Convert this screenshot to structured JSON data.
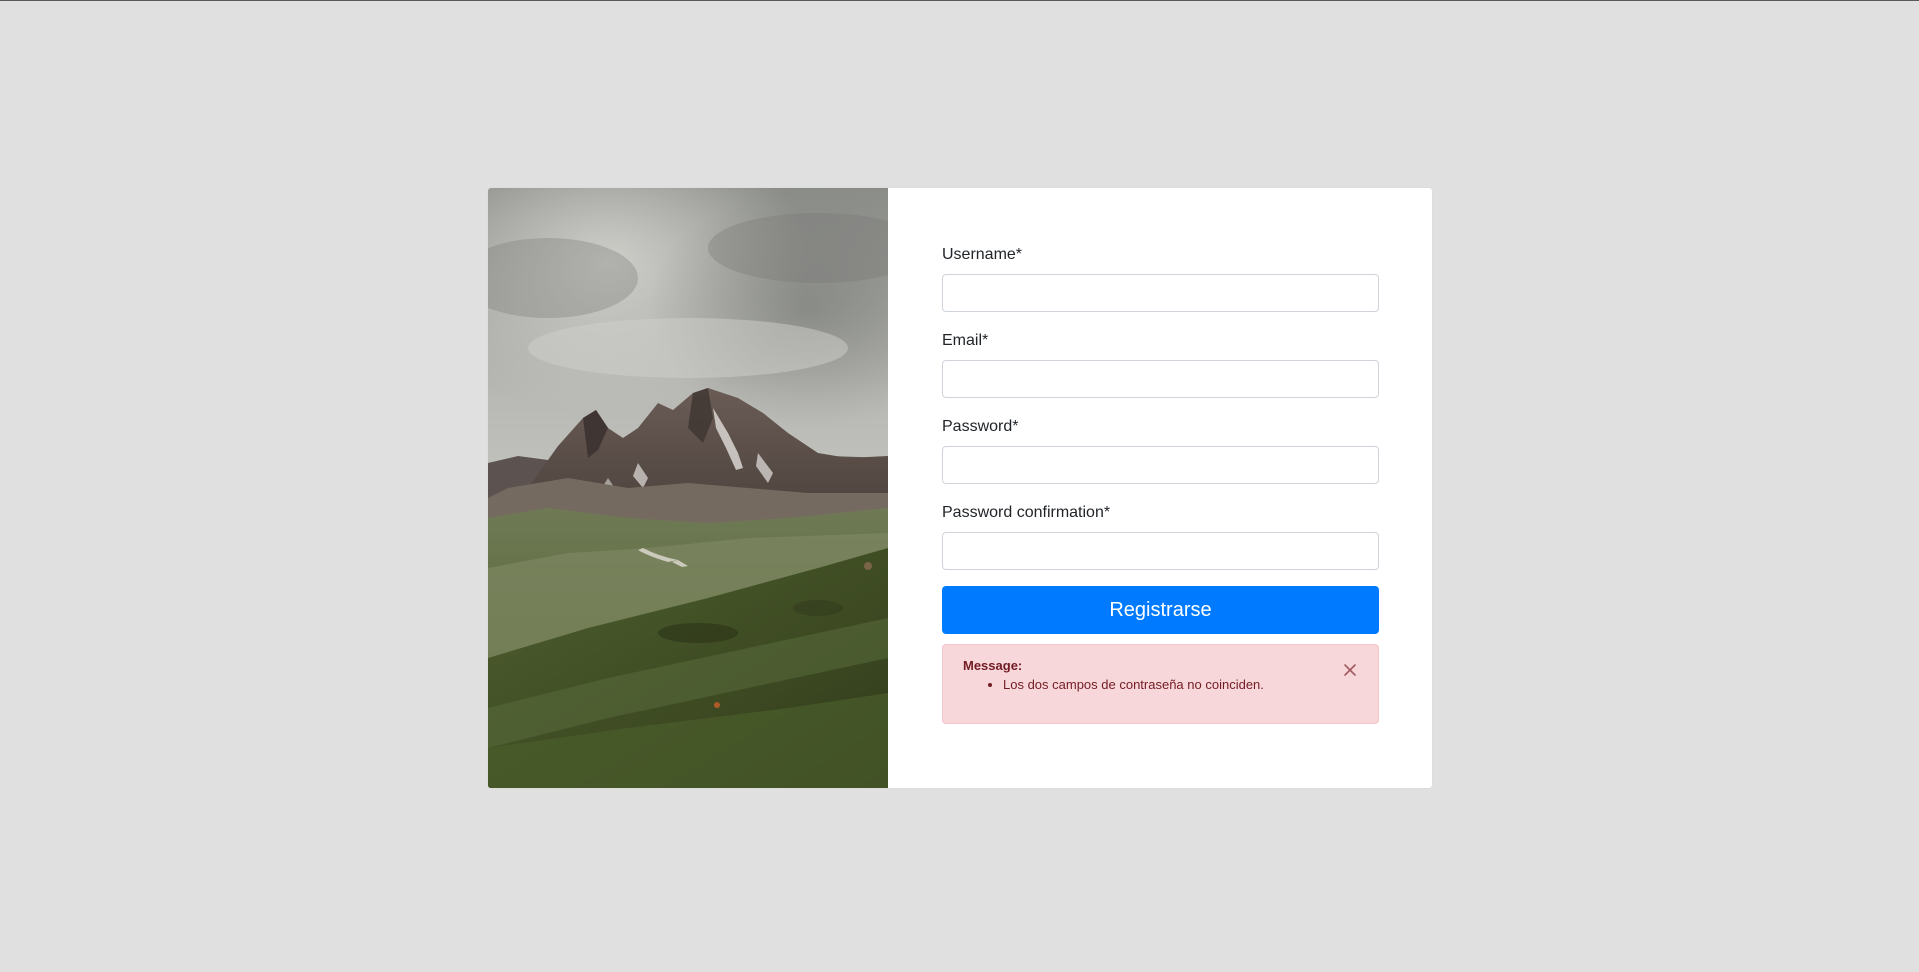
{
  "photo": {
    "description_icon": "mountain-landscape-image"
  },
  "form": {
    "fields": [
      {
        "label": "Username*",
        "value": "",
        "placeholder": ""
      },
      {
        "label": "Email*",
        "value": "",
        "placeholder": ""
      },
      {
        "label": "Password*",
        "value": "",
        "placeholder": ""
      },
      {
        "label": "Password confirmation*",
        "value": "",
        "placeholder": ""
      }
    ],
    "submit_label": "Registrarse"
  },
  "alert": {
    "title": "Message:",
    "items": [
      "Los dos campos de contraseña no coinciden."
    ],
    "close_icon": "close-icon"
  },
  "colors": {
    "background": "#e0e0e0",
    "primary": "#007bff",
    "alert_bg": "#f8d7da",
    "alert_text": "#721c24"
  }
}
